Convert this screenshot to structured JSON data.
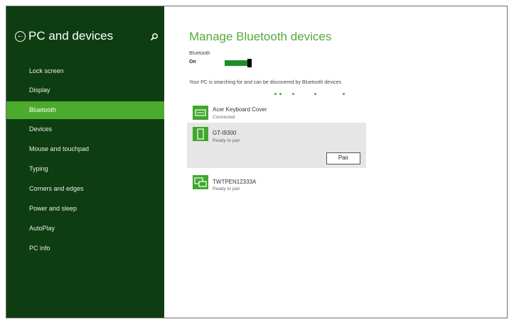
{
  "sidebar": {
    "title": "PC and devices",
    "items": [
      {
        "label": "Lock screen",
        "active": false
      },
      {
        "label": "Display",
        "active": false
      },
      {
        "label": "Bluetooth",
        "active": true
      },
      {
        "label": "Devices",
        "active": false
      },
      {
        "label": "Mouse and touchpad",
        "active": false
      },
      {
        "label": "Typing",
        "active": false
      },
      {
        "label": "Corners and edges",
        "active": false
      },
      {
        "label": "Power and sleep",
        "active": false
      },
      {
        "label": "AutoPlay",
        "active": false
      },
      {
        "label": "PC info",
        "active": false
      }
    ]
  },
  "main": {
    "title": "Manage Bluetooth devices",
    "bluetooth_label": "Bluetooth",
    "bluetooth_state": "On",
    "searching_text": "Your PC is searching for and can be discovered by Bluetooth devices",
    "devices": [
      {
        "name": "Acer Keyboard Cover",
        "status": "Connected",
        "icon": "keyboard-icon"
      },
      {
        "name": "GT-I9300",
        "status": "Ready to pair",
        "icon": "phone-icon"
      },
      {
        "name": "TWTPEN12333A",
        "status": "Ready to pair",
        "icon": "computer-icon"
      }
    ],
    "pair_label": "Pair"
  },
  "colors": {
    "sidebar_bg": "#0f3d12",
    "accent": "#4cab2d",
    "title_green": "#59a83e",
    "selected_device_bg": "#e6e6e6"
  }
}
